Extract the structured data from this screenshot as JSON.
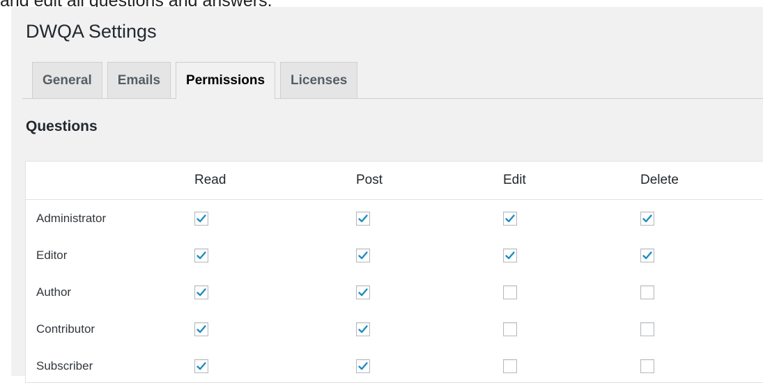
{
  "caption": "and edit all questions and answers.",
  "title": "DWQA Settings",
  "tabs": [
    {
      "label": "General",
      "active": false
    },
    {
      "label": "Emails",
      "active": false
    },
    {
      "label": "Permissions",
      "active": true
    },
    {
      "label": "Licenses",
      "active": false
    }
  ],
  "section_title": "Questions",
  "columns": [
    "Read",
    "Post",
    "Edit",
    "Delete"
  ],
  "rows": [
    {
      "role": "Administrator",
      "checked": [
        true,
        true,
        true,
        true
      ]
    },
    {
      "role": "Editor",
      "checked": [
        true,
        true,
        true,
        true
      ]
    },
    {
      "role": "Author",
      "checked": [
        true,
        true,
        false,
        false
      ]
    },
    {
      "role": "Contributor",
      "checked": [
        true,
        true,
        false,
        false
      ]
    },
    {
      "role": "Subscriber",
      "checked": [
        true,
        true,
        false,
        false
      ]
    }
  ],
  "colors": {
    "check": "#1e8cbe",
    "panel_bg": "#f1f1f1"
  }
}
